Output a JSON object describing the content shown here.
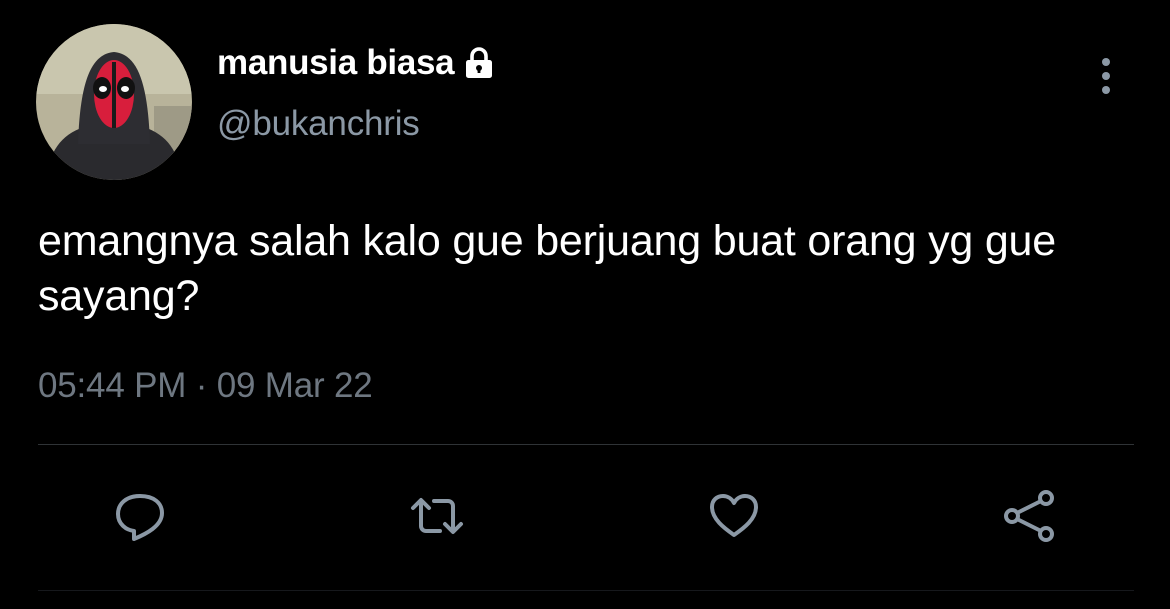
{
  "tweet": {
    "author": {
      "display_name": "manusia biasa",
      "handle": "@bukanchris",
      "protected": true
    },
    "text": "emangnya salah kalo gue berjuang buat orang yg gue sayang?",
    "timestamp": "05:44 PM · 09 Mar 22"
  },
  "actions": [
    {
      "name": "reply",
      "icon": "reply-icon"
    },
    {
      "name": "retweet",
      "icon": "retweet-icon"
    },
    {
      "name": "like",
      "icon": "heart-icon"
    },
    {
      "name": "share",
      "icon": "share-icon"
    }
  ],
  "colors": {
    "background": "#000000",
    "primary_text": "#ffffff",
    "secondary_text": "#8b98a5",
    "icon": "#8b98a5",
    "divider": "#2f3336"
  }
}
